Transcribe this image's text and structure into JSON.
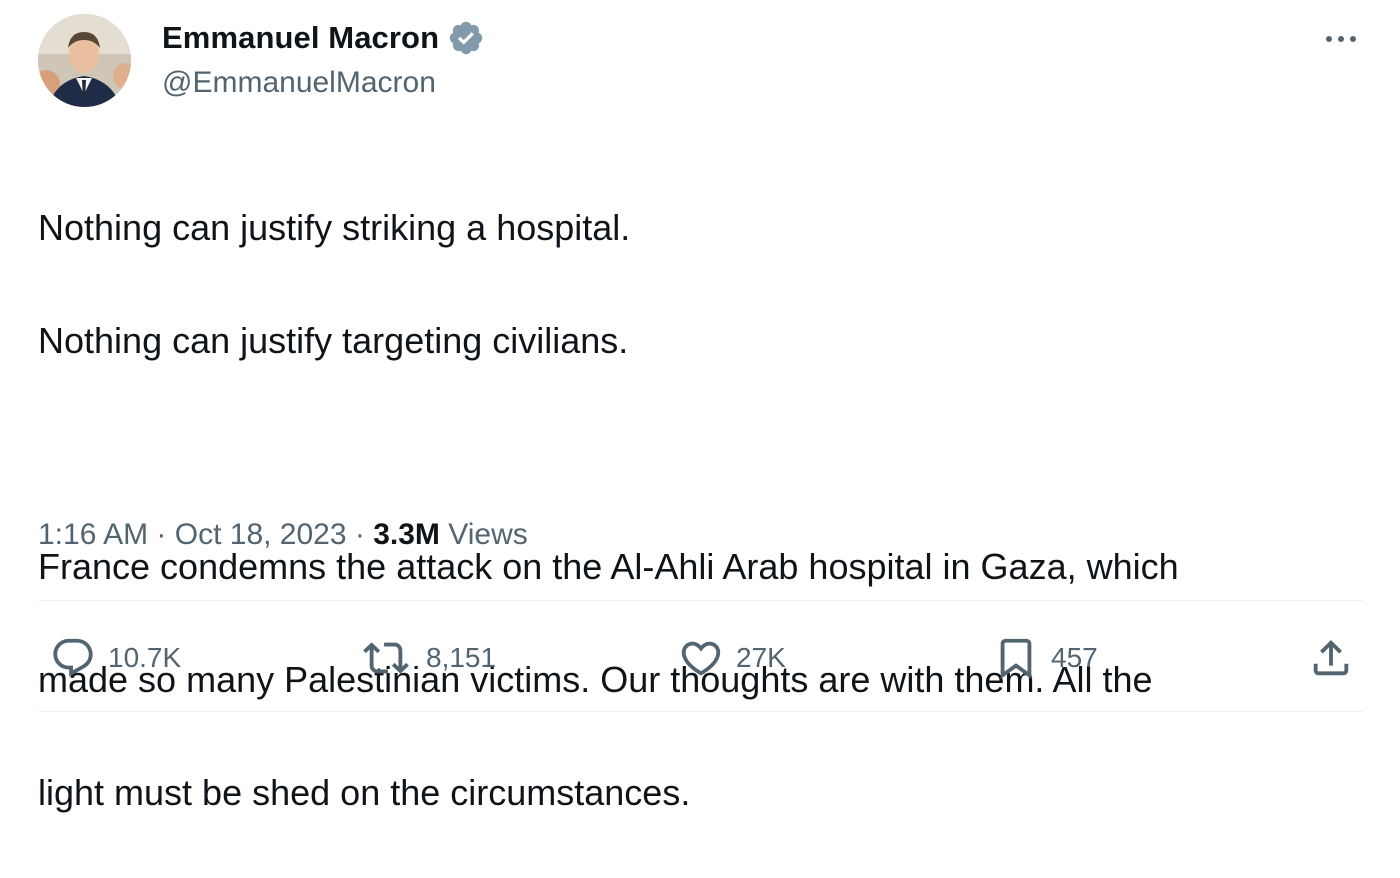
{
  "author": {
    "display_name": "Emmanuel Macron",
    "handle": "@EmmanuelMacron",
    "verified": true,
    "verified_color": "#829aab"
  },
  "tweet": {
    "lines": [
      "Nothing can justify striking a hospital.",
      "Nothing can justify targeting civilians.",
      "",
      "France condemns the attack on the Al-Ahli Arab hospital in Gaza, which",
      "made so many Palestinian victims. Our thoughts are with them. All the",
      "light must be shed on the circumstances."
    ]
  },
  "meta": {
    "time": "1:16 AM",
    "separator": " · ",
    "date": "Oct 18, 2023",
    "views_count": "3.3M",
    "views_label": " Views"
  },
  "actions": {
    "replies": "10.7K",
    "reposts": "8,151",
    "likes": "27K",
    "bookmarks": "457"
  },
  "icons": {
    "more": "more-horizontal-icon",
    "reply": "reply-bubble-icon",
    "repost": "repost-arrows-icon",
    "like": "heart-icon",
    "bookmark": "bookmark-icon",
    "share": "share-upload-icon",
    "verified": "verified-badge-icon"
  },
  "colors": {
    "text_primary": "#0f1419",
    "text_secondary": "#536471",
    "divider": "#eff3f4"
  }
}
